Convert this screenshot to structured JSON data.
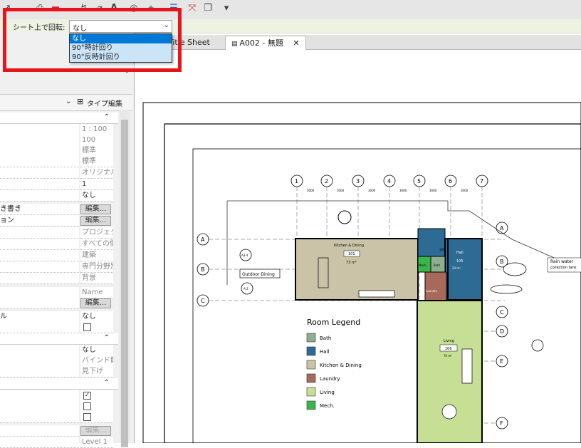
{
  "options_bar": {
    "label": "シート上で回転:",
    "value": "なし"
  },
  "dropdown": {
    "options": [
      "なし",
      "90°時計回り",
      "90°反時計回り"
    ]
  },
  "tabs": [
    "Title Sheet",
    "A002 - 無題"
  ],
  "close_glyph": "✕",
  "type_bar": {
    "edit_type": "タイプ編集"
  },
  "properties": [
    {
      "k": "",
      "v": "1 : 100",
      "gray": true
    },
    {
      "k": "",
      "v": "100",
      "gray": true
    },
    {
      "k": "",
      "v": "標準",
      "gray": true
    },
    {
      "k": "",
      "v": "標準",
      "gray": true
    },
    {
      "k": "",
      "v": "オリジナルを表示",
      "gray": true
    },
    {
      "k": "",
      "v": "1"
    },
    {
      "k": "",
      "v": "なし"
    },
    {
      "k": "き書き",
      "btn": "編集..."
    },
    {
      "k": "ョン",
      "btn": "編集..."
    },
    {
      "k": "",
      "v": "プロジェクトの北",
      "gray": true
    },
    {
      "k": "",
      "v": "すべての壁を包絡",
      "gray": true
    },
    {
      "k": "",
      "v": "建築",
      "gray": true
    },
    {
      "k": "",
      "v": "専門分野別",
      "gray": true
    },
    {
      "k": "",
      "v": "背景",
      "gray": true
    },
    {
      "k": "",
      "v": "Name",
      "gray": true
    },
    {
      "k": "",
      "btn": "編集..."
    },
    {
      "k": "ル",
      "v": "なし"
    }
  ],
  "properties_lower": [
    {
      "k": "",
      "v": "なし"
    },
    {
      "k": "",
      "v": "バインド解除",
      "gray": true
    },
    {
      "k": "",
      "v": "見下げ",
      "gray": true
    }
  ],
  "properties_last": {
    "btn": "編集...",
    "level": "Level 1"
  },
  "plan": {
    "grid_cols": [
      "1",
      "2",
      "3",
      "4",
      "5",
      "6",
      "7"
    ],
    "grid_rows": [
      "A",
      "B",
      "C",
      "D",
      "E",
      "F"
    ],
    "dim": "3000",
    "rooms": {
      "kitchen": "Kitchen & Dining",
      "kitchen_num": "101",
      "kitchen_area": "73 m²",
      "hall": "Hall",
      "hall_num": "105",
      "hall_area": "24 m²",
      "bath": "Bath",
      "bath_num": "104",
      "mech": "Mech.",
      "laundry": "Laundry",
      "living": "Living",
      "living_num": "106",
      "living_area": "70 m²"
    },
    "outdoor": "Outdoor Dining",
    "rain": "Rain water",
    "rain2": "collection tank",
    "tag_a": "A3-4",
    "tag_b": "A-2",
    "legend_title": "Room Legend",
    "legend": [
      {
        "name": "Bath",
        "color": "#8fae8f"
      },
      {
        "name": "Hall",
        "color": "#2d6a94"
      },
      {
        "name": "Kitchen & Dining",
        "color": "#cbc3a8"
      },
      {
        "name": "Laundry",
        "color": "#a7695a"
      },
      {
        "name": "Living",
        "color": "#c7df95"
      },
      {
        "name": "Mech.",
        "color": "#3ab54a"
      }
    ]
  }
}
